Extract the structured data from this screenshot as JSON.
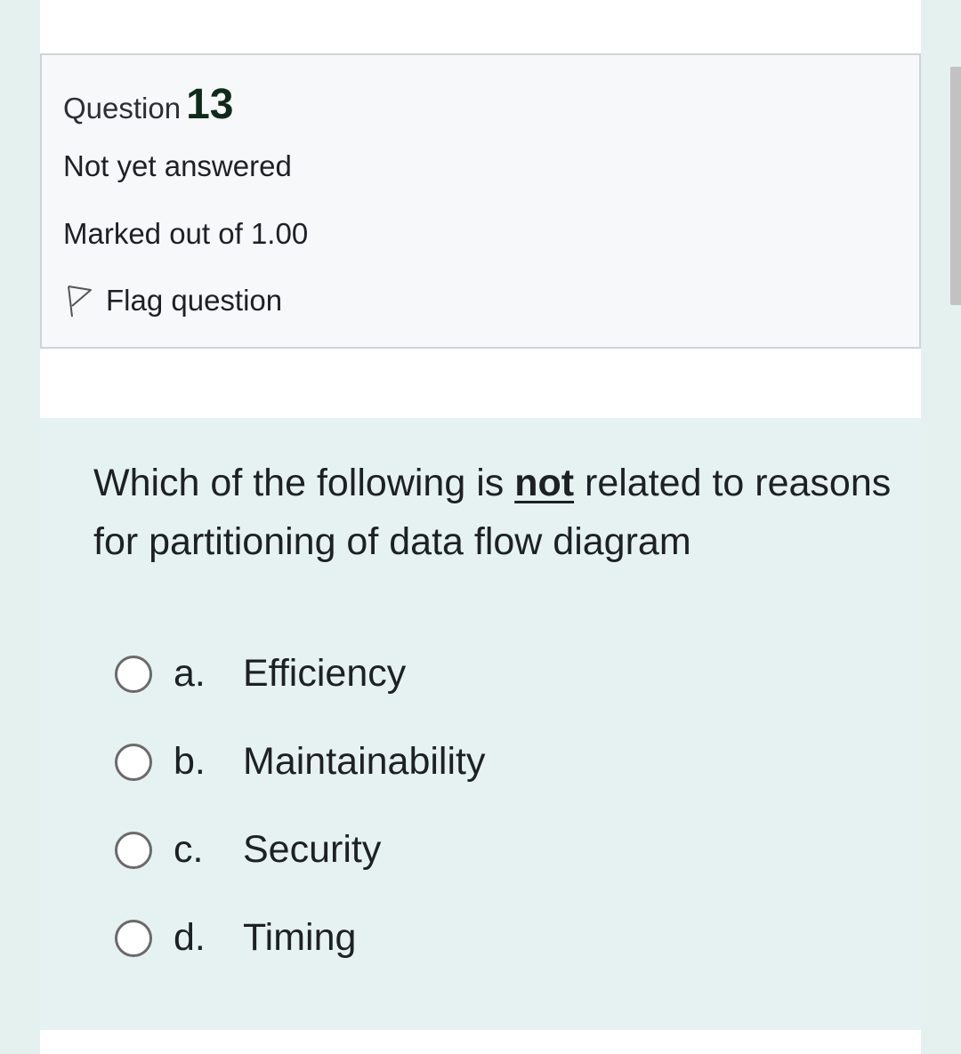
{
  "question": {
    "label": "Question",
    "number": "13",
    "state": "Not yet answered",
    "grade": "Marked out of 1.00",
    "flag_label": "Flag question"
  },
  "question_text": {
    "before": "Which of the following is ",
    "emphasis": "not",
    "after": " related to reasons for partitioning of data flow diagram"
  },
  "options": [
    {
      "letter": "a.",
      "text": "Efficiency",
      "selected": false
    },
    {
      "letter": "b.",
      "text": "Maintainability",
      "selected": false
    },
    {
      "letter": "c.",
      "text": "Security",
      "selected": false
    },
    {
      "letter": "d.",
      "text": "Timing",
      "selected": false
    }
  ],
  "icons": {
    "flag": "flag-outline-icon"
  },
  "colors": {
    "page_background": "#e5f1ee",
    "info_box_background": "#f7f8fa",
    "content_background": "#e6f2f2",
    "question_number": "#0f2a1a"
  }
}
